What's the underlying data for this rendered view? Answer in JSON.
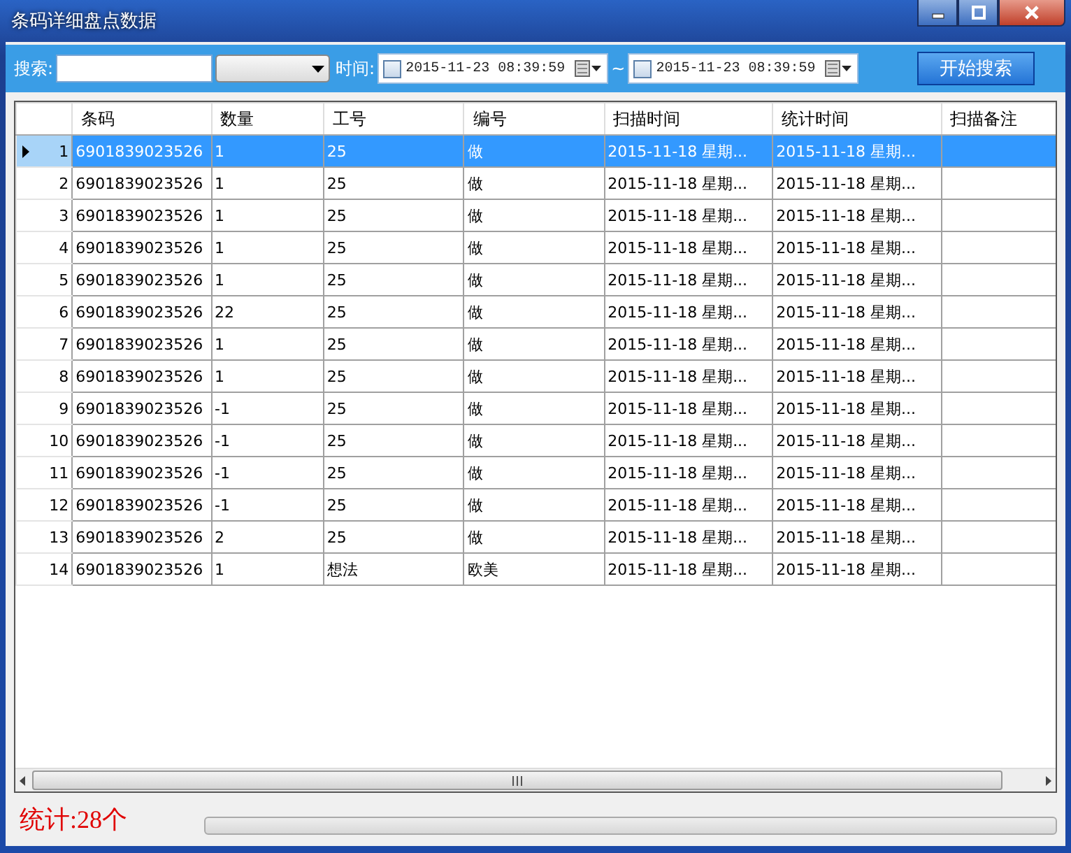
{
  "window": {
    "title": "条码详细盘点数据"
  },
  "search": {
    "label": "搜索:",
    "time_label": "时间:",
    "separator": "~",
    "button": "开始搜索",
    "from": {
      "checked": false,
      "value": "2015-11-23 08:39:59"
    },
    "to": {
      "checked": false,
      "value": "2015-11-23 08:39:59"
    }
  },
  "table": {
    "columns": [
      "条码",
      "数量",
      "工号",
      "编号",
      "扫描时间",
      "统计时间",
      "扫描备注"
    ],
    "rows": [
      {
        "index": "1",
        "selected": true,
        "cells": [
          "6901839023526",
          "1",
          "25",
          "做",
          "2015-11-18 星期...",
          "2015-11-18 星期...",
          ""
        ]
      },
      {
        "index": "2",
        "selected": false,
        "cells": [
          "6901839023526",
          "1",
          "25",
          "做",
          "2015-11-18 星期...",
          "2015-11-18 星期...",
          ""
        ]
      },
      {
        "index": "3",
        "selected": false,
        "cells": [
          "6901839023526",
          "1",
          "25",
          "做",
          "2015-11-18 星期...",
          "2015-11-18 星期...",
          ""
        ]
      },
      {
        "index": "4",
        "selected": false,
        "cells": [
          "6901839023526",
          "1",
          "25",
          "做",
          "2015-11-18 星期...",
          "2015-11-18 星期...",
          ""
        ]
      },
      {
        "index": "5",
        "selected": false,
        "cells": [
          "6901839023526",
          "1",
          "25",
          "做",
          "2015-11-18 星期...",
          "2015-11-18 星期...",
          ""
        ]
      },
      {
        "index": "6",
        "selected": false,
        "cells": [
          "6901839023526",
          "22",
          "25",
          "做",
          "2015-11-18 星期...",
          "2015-11-18 星期...",
          ""
        ]
      },
      {
        "index": "7",
        "selected": false,
        "cells": [
          "6901839023526",
          "1",
          "25",
          "做",
          "2015-11-18 星期...",
          "2015-11-18 星期...",
          ""
        ]
      },
      {
        "index": "8",
        "selected": false,
        "cells": [
          "6901839023526",
          "1",
          "25",
          "做",
          "2015-11-18 星期...",
          "2015-11-18 星期...",
          ""
        ]
      },
      {
        "index": "9",
        "selected": false,
        "cells": [
          "6901839023526",
          "-1",
          "25",
          "做",
          "2015-11-18 星期...",
          "2015-11-18 星期...",
          ""
        ]
      },
      {
        "index": "10",
        "selected": false,
        "cells": [
          "6901839023526",
          "-1",
          "25",
          "做",
          "2015-11-18 星期...",
          "2015-11-18 星期...",
          ""
        ]
      },
      {
        "index": "11",
        "selected": false,
        "cells": [
          "6901839023526",
          "-1",
          "25",
          "做",
          "2015-11-18 星期...",
          "2015-11-18 星期...",
          ""
        ]
      },
      {
        "index": "12",
        "selected": false,
        "cells": [
          "6901839023526",
          "-1",
          "25",
          "做",
          "2015-11-18 星期...",
          "2015-11-18 星期...",
          ""
        ]
      },
      {
        "index": "13",
        "selected": false,
        "cells": [
          "6901839023526",
          "2",
          "25",
          "做",
          "2015-11-18 星期...",
          "2015-11-18 星期...",
          ""
        ]
      },
      {
        "index": "14",
        "selected": false,
        "cells": [
          "6901839023526",
          "1",
          "想法",
          "欧美",
          "2015-11-18 星期...",
          "2015-11-18 星期...",
          ""
        ]
      }
    ]
  },
  "status": {
    "count": "统计:28个",
    "progress": {
      "level": 0
    }
  }
}
